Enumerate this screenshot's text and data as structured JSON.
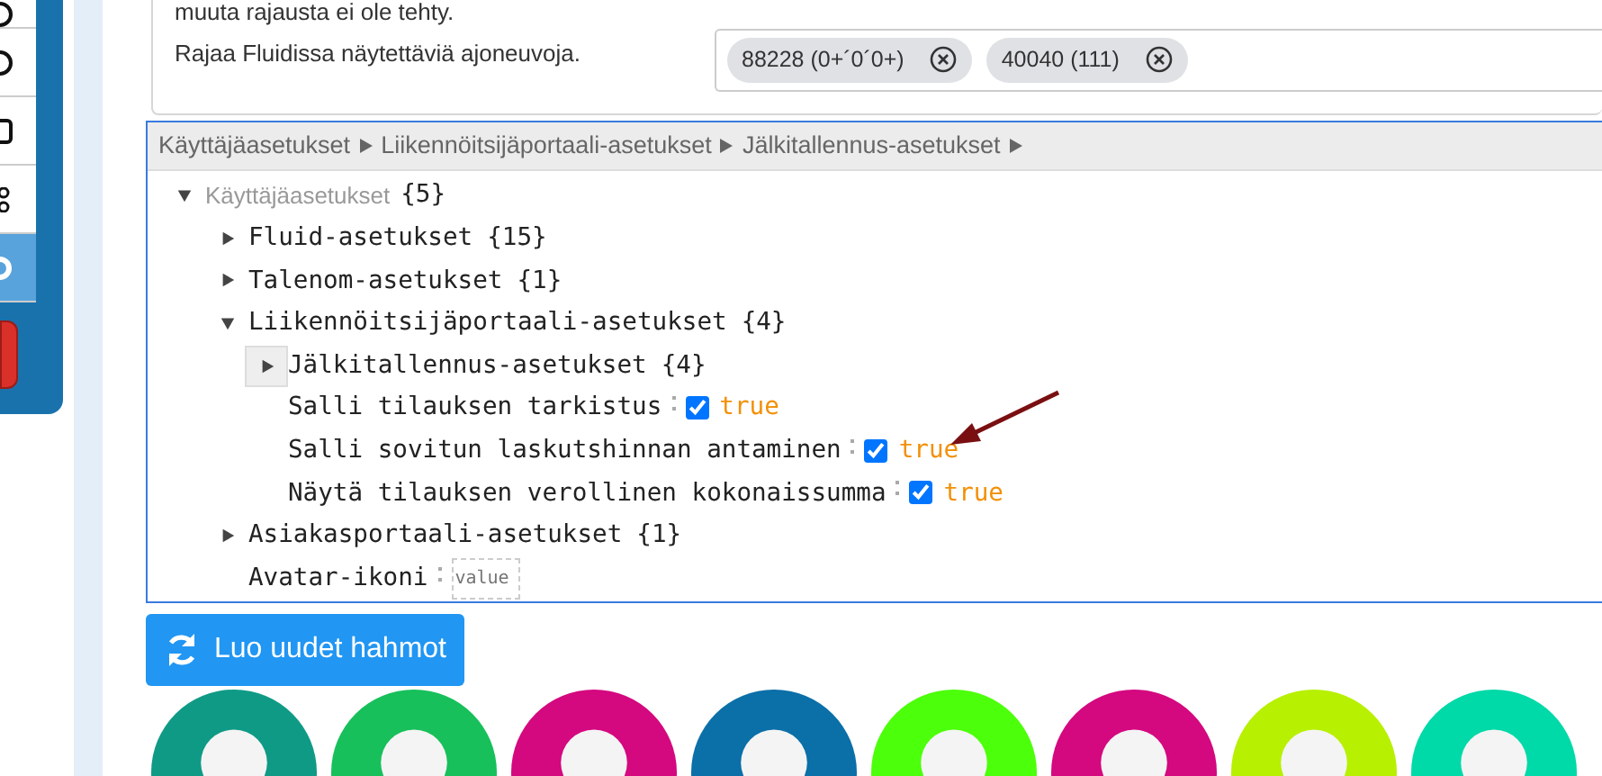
{
  "sidebar": {
    "items": [
      {
        "selected": false
      },
      {
        "selected": false
      },
      {
        "selected": false
      },
      {
        "selected": false
      },
      {
        "selected": true
      }
    ]
  },
  "filter": {
    "note": "muuta rajausta ei ole tehty.",
    "label": "Rajaa Fluidissa näytettäviä ajoneuvoja.",
    "tags": [
      "88228 (0+´0´0+)",
      "40040 (111)"
    ]
  },
  "settings": {
    "breadcrumb": [
      "Käyttäjäasetukset",
      "Liikennöitsijäportaali-asetukset",
      "Jälkitallennus-asetukset"
    ],
    "tree": [
      {
        "kind": "group",
        "label": "Käyttäjäasetukset",
        "count": "{5}",
        "expanded": true,
        "children": [
          {
            "kind": "group",
            "label": "Fluid-asetukset",
            "count": "{15}",
            "expanded": false
          },
          {
            "kind": "group",
            "label": "Talenom-asetukset",
            "count": "{1}",
            "expanded": false
          },
          {
            "kind": "group",
            "label": "Liikennöitsijäportaali-asetukset",
            "count": "{4}",
            "expanded": true,
            "children": [
              {
                "kind": "group",
                "label": "Jälkitallennus-asetukset",
                "count": "{4}",
                "expanded": false,
                "hovered": true
              },
              {
                "kind": "checkbox",
                "label": "Salli tilauksen tarkistus",
                "checked": true,
                "value": "true"
              },
              {
                "kind": "checkbox",
                "label": "Salli sovitun laskutshinnan antaminen",
                "checked": true,
                "value": "true"
              },
              {
                "kind": "checkbox",
                "label": "Näytä tilauksen verollinen kokonaissumma",
                "checked": true,
                "value": "true"
              }
            ]
          },
          {
            "kind": "group",
            "label": "Asiakasportaali-asetukset",
            "count": "{1}",
            "expanded": false
          },
          {
            "kind": "field",
            "label": "Avatar-ikoni",
            "placeholder": "value"
          }
        ]
      }
    ]
  },
  "regenerate_button": "Luo uudet hahmot",
  "avatars": [
    {
      "color": "#0f9a86"
    },
    {
      "color": "#17c05a"
    },
    {
      "color": "#d4087f"
    },
    {
      "color": "#0b6fa8"
    },
    {
      "color": "#4cff0a"
    },
    {
      "color": "#d4087f"
    },
    {
      "color": "#b7f000"
    },
    {
      "color": "#00d9a8"
    }
  ]
}
